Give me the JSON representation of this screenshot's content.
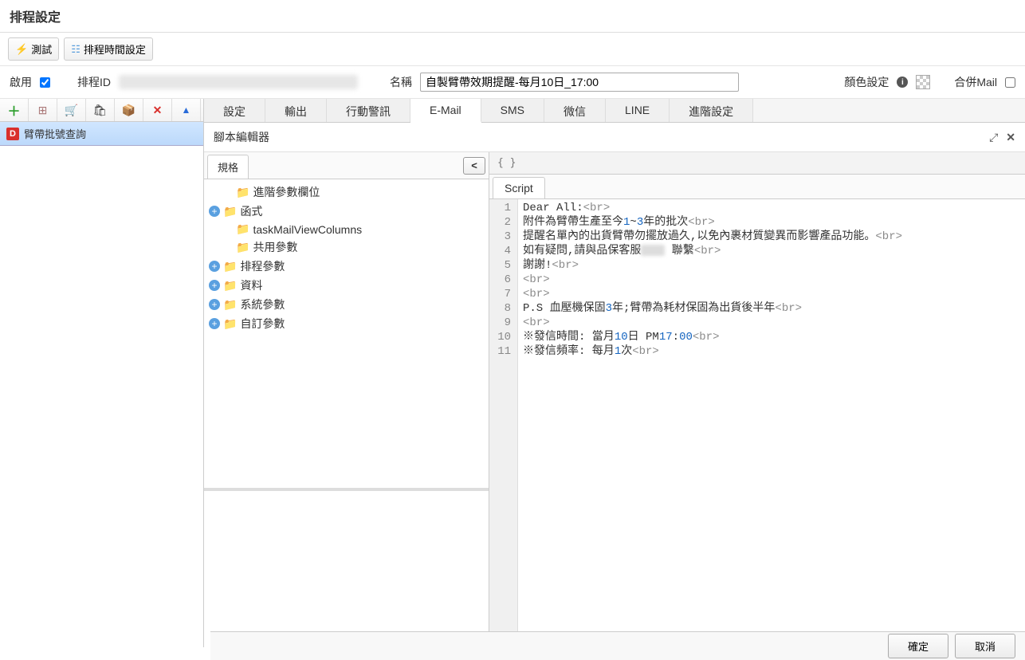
{
  "window": {
    "title": "排程設定"
  },
  "top_buttons": {
    "test": "測試",
    "schedule_time": "排程時間設定"
  },
  "form": {
    "enable_label": "啟用",
    "enable_checked": true,
    "schedule_id_label": "排程ID",
    "name_label": "名稱",
    "name_value": "自製臂帶效期提醒-每月10日_17:00",
    "color_label": "顏色設定",
    "merge_mail_label": "合併Mail"
  },
  "left_list": {
    "item1": "臂帶批號查詢"
  },
  "tabs": {
    "t1": "設定",
    "t2": "輸出",
    "t3": "行動警訊",
    "t4": "E-Mail",
    "t5": "SMS",
    "t6": "微信",
    "t7": "LINE",
    "t8": "進階設定"
  },
  "editor": {
    "title": "腳本編輯器"
  },
  "tree_tab": "規格",
  "tree": {
    "n1": "進階參數欄位",
    "n2": "函式",
    "n3": "taskMailViewColumns",
    "n4": "共用參數",
    "n5": "排程參數",
    "n6": "資料",
    "n7": "系統參數",
    "n8": "自訂參數"
  },
  "code_tab": "Script",
  "script": {
    "l1a": "Dear All:",
    "br": "<br>",
    "l2a": "附件為臂帶生產至今",
    "l2b": "1",
    "l2c": "~",
    "l2d": "3",
    "l2e": "年的批次",
    "l3a": "提醒名單內的出貨臂帶勿擺放過久,以免內裹材質變異而影響產品功能。",
    "l4a": "如有疑問,請與品保客服",
    "l4b": " 聯繫",
    "l5a": "謝謝!",
    "l8a": "P.S 血壓機保固",
    "l8b": "3",
    "l8c": "年;臂帶為耗材保固為出貨後半年",
    "l10a": "※發信時間: 當月",
    "l10b": "10",
    "l10c": "日 PM",
    "l10d": "17",
    "l10e": ":",
    "l10f": "00",
    "l11a": "※發信頻率: 每月",
    "l11b": "1",
    "l11c": "次"
  },
  "footer": {
    "ok": "確定",
    "cancel": "取消"
  }
}
